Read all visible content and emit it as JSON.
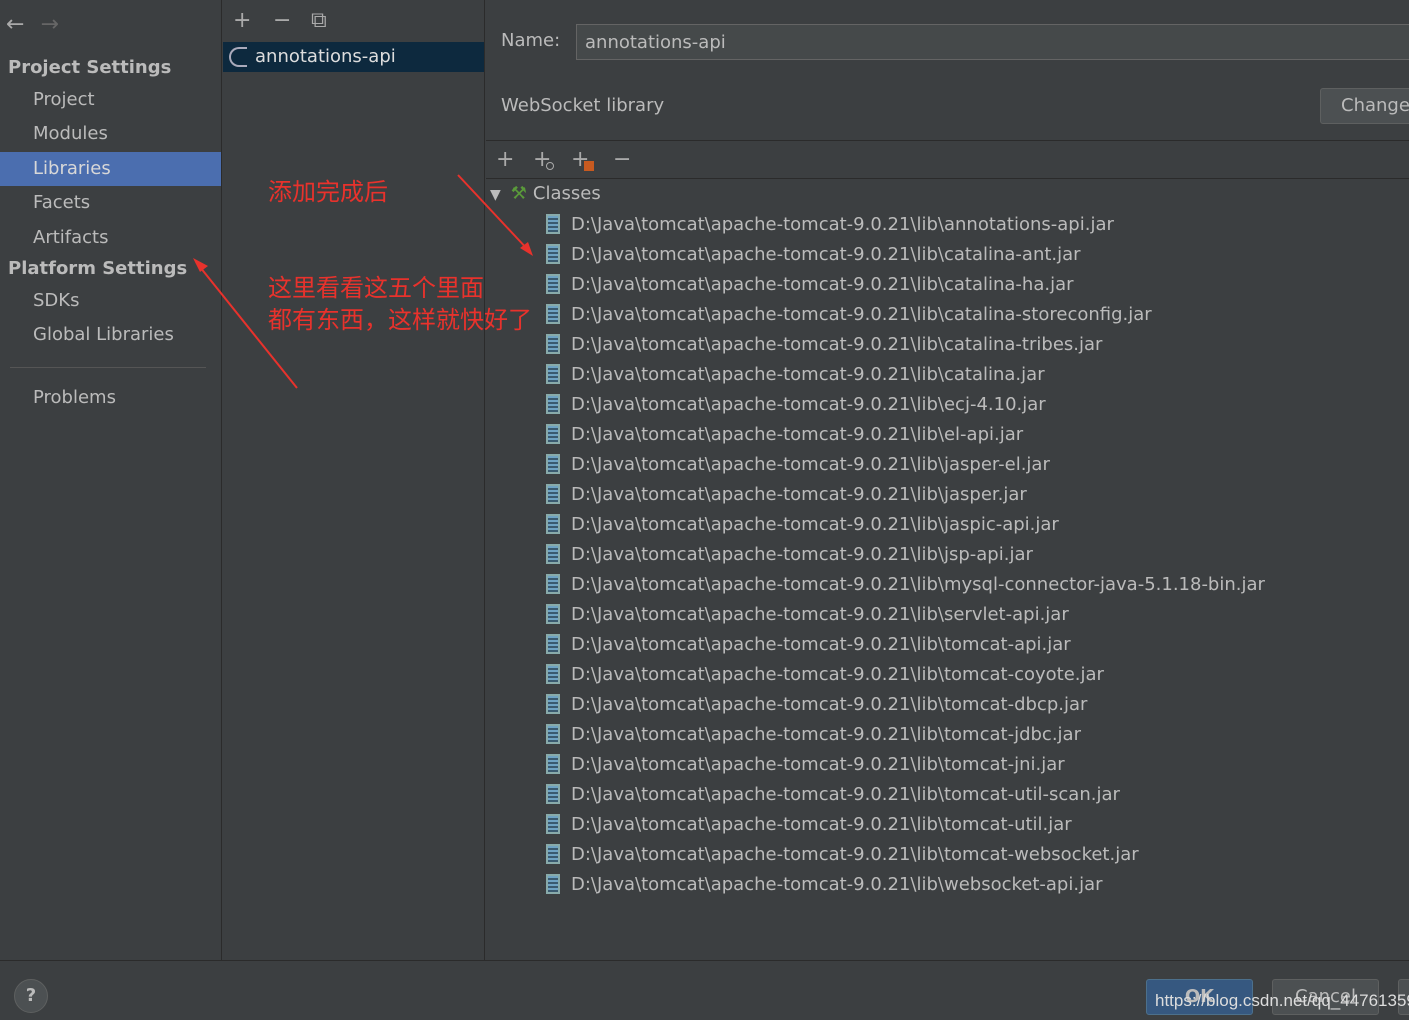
{
  "nav": {
    "back": "←",
    "forward": "→"
  },
  "sidebar": {
    "project_settings": "Project Settings",
    "platform_settings": "Platform Settings",
    "items": [
      {
        "label": "Project"
      },
      {
        "label": "Modules"
      },
      {
        "label": "Libraries",
        "selected": true
      },
      {
        "label": "Facets"
      },
      {
        "label": "Artifacts"
      },
      {
        "label": "SDKs"
      },
      {
        "label": "Global Libraries"
      },
      {
        "label": "Problems"
      }
    ]
  },
  "libraries": {
    "toolbar": {
      "add": "+",
      "remove": "−",
      "copy": "⧉"
    },
    "selected": "annotations-api"
  },
  "detail": {
    "name_label": "Name:",
    "name_value": "annotations-api",
    "kind": "WebSocket library",
    "change_button": "Change",
    "toolbar": {
      "add": "+",
      "add_url": "+",
      "add_special": "+",
      "remove": "−"
    },
    "classes_label": "Classes",
    "jars": [
      "D:\\Java\\tomcat\\apache-tomcat-9.0.21\\lib\\annotations-api.jar",
      "D:\\Java\\tomcat\\apache-tomcat-9.0.21\\lib\\catalina-ant.jar",
      "D:\\Java\\tomcat\\apache-tomcat-9.0.21\\lib\\catalina-ha.jar",
      "D:\\Java\\tomcat\\apache-tomcat-9.0.21\\lib\\catalina-storeconfig.jar",
      "D:\\Java\\tomcat\\apache-tomcat-9.0.21\\lib\\catalina-tribes.jar",
      "D:\\Java\\tomcat\\apache-tomcat-9.0.21\\lib\\catalina.jar",
      "D:\\Java\\tomcat\\apache-tomcat-9.0.21\\lib\\ecj-4.10.jar",
      "D:\\Java\\tomcat\\apache-tomcat-9.0.21\\lib\\el-api.jar",
      "D:\\Java\\tomcat\\apache-tomcat-9.0.21\\lib\\jasper-el.jar",
      "D:\\Java\\tomcat\\apache-tomcat-9.0.21\\lib\\jasper.jar",
      "D:\\Java\\tomcat\\apache-tomcat-9.0.21\\lib\\jaspic-api.jar",
      "D:\\Java\\tomcat\\apache-tomcat-9.0.21\\lib\\jsp-api.jar",
      "D:\\Java\\tomcat\\apache-tomcat-9.0.21\\lib\\mysql-connector-java-5.1.18-bin.jar",
      "D:\\Java\\tomcat\\apache-tomcat-9.0.21\\lib\\servlet-api.jar",
      "D:\\Java\\tomcat\\apache-tomcat-9.0.21\\lib\\tomcat-api.jar",
      "D:\\Java\\tomcat\\apache-tomcat-9.0.21\\lib\\tomcat-coyote.jar",
      "D:\\Java\\tomcat\\apache-tomcat-9.0.21\\lib\\tomcat-dbcp.jar",
      "D:\\Java\\tomcat\\apache-tomcat-9.0.21\\lib\\tomcat-jdbc.jar",
      "D:\\Java\\tomcat\\apache-tomcat-9.0.21\\lib\\tomcat-jni.jar",
      "D:\\Java\\tomcat\\apache-tomcat-9.0.21\\lib\\tomcat-util-scan.jar",
      "D:\\Java\\tomcat\\apache-tomcat-9.0.21\\lib\\tomcat-util.jar",
      "D:\\Java\\tomcat\\apache-tomcat-9.0.21\\lib\\tomcat-websocket.jar",
      "D:\\Java\\tomcat\\apache-tomcat-9.0.21\\lib\\websocket-api.jar"
    ]
  },
  "annotations": {
    "note1": "添加完成后",
    "note2_line1": "这里看看这五个里面",
    "note2_line2": "都有东西，这样就快好了",
    "color": "#e8322c"
  },
  "footer": {
    "help": "?",
    "ok": "OK",
    "cancel": "Cancel",
    "watermark": "https://blog.csdn.net/qq_44761359"
  }
}
